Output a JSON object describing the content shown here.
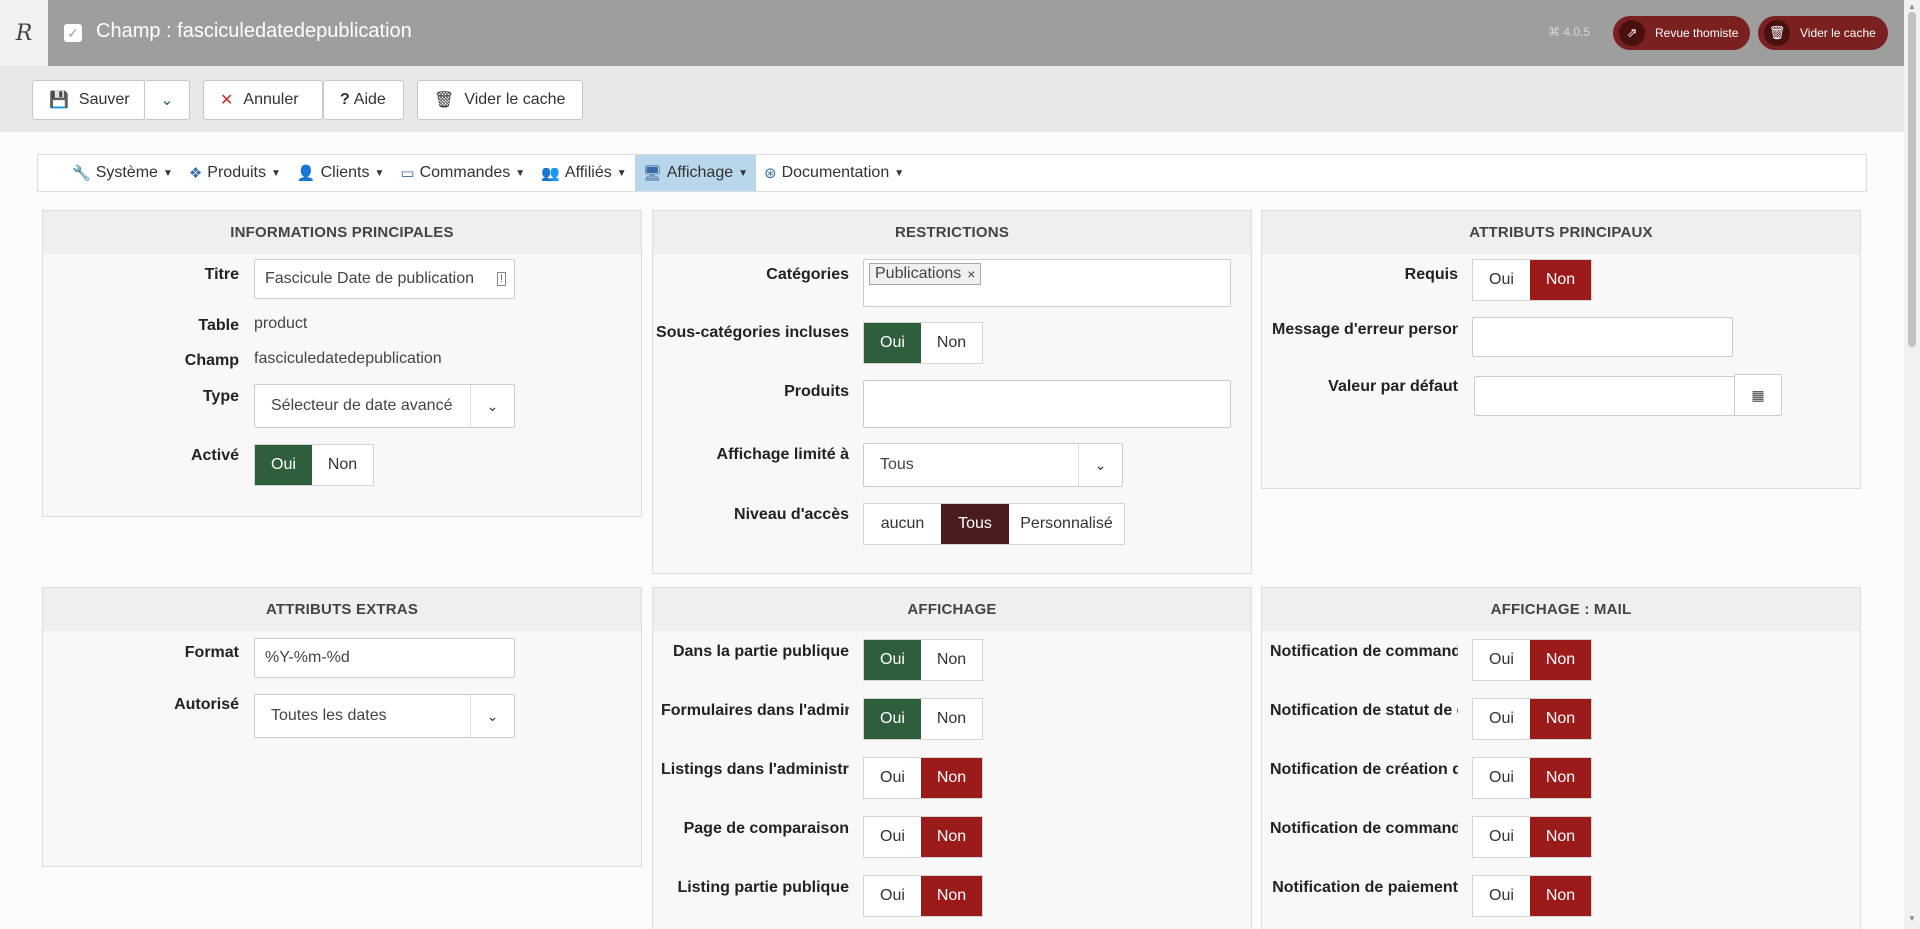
{
  "header": {
    "logo": "R",
    "title": "Champ : fasciculedatedepublication",
    "version": "4.0.5",
    "buttons": [
      {
        "label": "Revue thomiste",
        "icon": "external-link-icon"
      },
      {
        "label": "Vider le cache",
        "icon": "trash-icon"
      }
    ]
  },
  "toolbar": {
    "save": "Sauver",
    "cancel": "Annuler",
    "help": "Aide",
    "clear_cache": "Vider le cache"
  },
  "menu": [
    {
      "label": "Système",
      "icon": "wrench-icon"
    },
    {
      "label": "Produits",
      "icon": "cubes-icon"
    },
    {
      "label": "Clients",
      "icon": "user-icon"
    },
    {
      "label": "Commandes",
      "icon": "credit-card-icon"
    },
    {
      "label": "Affiliés",
      "icon": "users-cog-icon"
    },
    {
      "label": "Affichage",
      "icon": "desktop-icon",
      "active": true
    },
    {
      "label": "Documentation",
      "icon": "life-ring-icon"
    }
  ],
  "panels": {
    "main_info": {
      "title": "INFORMATIONS PRINCIPALES",
      "titre_label": "Titre",
      "titre_value": "Fascicule Date de publication",
      "table_label": "Table",
      "table_value": "product",
      "champ_label": "Champ",
      "champ_value": "fasciculedatedepublication",
      "type_label": "Type",
      "type_value": "Sélecteur de date avancé",
      "active_label": "Activé",
      "yes": "Oui",
      "no": "Non"
    },
    "restrictions": {
      "title": "RESTRICTIONS",
      "categories_label": "Catégories",
      "categories_tag": "Publications",
      "subcat_label": "Sous-catégories incluses",
      "products_label": "Produits",
      "limited_label": "Affichage limité à",
      "limited_value": "Tous",
      "access_label": "Niveau d'accès",
      "access_options": [
        "aucun",
        "Tous",
        "Personnalisé"
      ],
      "yes": "Oui",
      "no": "Non"
    },
    "main_attrs": {
      "title": "ATTRIBUTS PRINCIPAUX",
      "required_label": "Requis",
      "error_label": "Message d'erreur personnalisé",
      "default_label": "Valeur par défaut",
      "yes": "Oui",
      "no": "Non"
    },
    "extra_attrs": {
      "title": "ATTRIBUTS EXTRAS",
      "format_label": "Format",
      "format_value": "%Y-%m-%d",
      "allowed_label": "Autorisé",
      "allowed_value": "Toutes les dates"
    },
    "display": {
      "title": "AFFICHAGE",
      "rows": [
        {
          "label": "Dans la partie publique",
          "value": "Oui"
        },
        {
          "label": "Formulaires dans l'administration",
          "value": "Oui"
        },
        {
          "label": "Listings dans l'administration",
          "value": "Non"
        },
        {
          "label": "Page de comparaison",
          "value": "Non"
        },
        {
          "label": "Listing partie publique",
          "value": "Non"
        }
      ],
      "yes": "Oui",
      "no": "Non"
    },
    "display_mail": {
      "title": "AFFICHAGE : MAIL",
      "rows": [
        {
          "label": "Notification de commande",
          "value": "Non"
        },
        {
          "label": "Notification de statut de commande",
          "value": "Non"
        },
        {
          "label": "Notification de création de commande",
          "value": "Non"
        },
        {
          "label": "Notification de commande",
          "value": "Non"
        },
        {
          "label": "Notification de paiement",
          "value": "Non"
        }
      ],
      "yes": "Oui",
      "no": "Non"
    }
  },
  "colors": {
    "header_bg": "#9e9e9e",
    "green_on": "#2f5e3d",
    "red_on": "#9b1b1b",
    "dark_on": "#4a1c1c",
    "pill_bg": "#7a2020"
  }
}
